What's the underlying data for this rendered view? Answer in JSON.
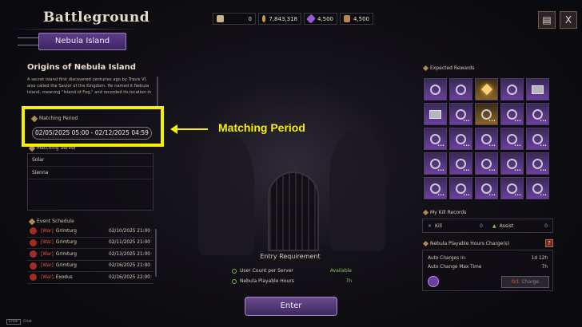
{
  "header": {
    "title": "Battleground",
    "active_tab": "Nebula Island",
    "currencies": [
      {
        "icon": "arrow-currency-icon",
        "value": "0",
        "color": "#c9b58a"
      },
      {
        "icon": "gold-coin-icon",
        "value": "7,843,318",
        "color": "#d79b3c"
      },
      {
        "icon": "purple-crystal-icon",
        "value": "4,500",
        "color": "#9a5ad6"
      },
      {
        "icon": "hexagon-token-icon",
        "value": "4,500",
        "color": "#b9864a"
      }
    ],
    "bag_icon": "bag-icon",
    "close_label": "X"
  },
  "origins": {
    "title": "Origins of Nebula Island",
    "text": "A secret island first discovered centuries ago by Travis VI, also called the Savior of the Kingdom. He named it Nebula Island, meaning \"Island of Fog,\" and recorded its location in"
  },
  "matching_period": {
    "label": "Matching Period",
    "value": "02/05/2025 05:00 - 02/12/2025 04:59"
  },
  "matching_server": {
    "label": "Matching Server",
    "servers": [
      "Solar",
      "Sienna"
    ]
  },
  "event_schedule": {
    "label": "Event Schedule",
    "rows": [
      {
        "tag": "[War]",
        "name": "Grimturg",
        "date": "02/10/2025 21:00"
      },
      {
        "tag": "[War]",
        "name": "Grimturg",
        "date": "02/11/2025 21:00"
      },
      {
        "tag": "[War]",
        "name": "Grimturg",
        "date": "02/13/2025 21:00"
      },
      {
        "tag": "[War]",
        "name": "Grimturg",
        "date": "02/16/2025 21:00"
      },
      {
        "tag": "[War]",
        "name": "Exodus",
        "date": "02/16/2025 22:00"
      }
    ]
  },
  "callout": {
    "text": "Matching Period",
    "color": "#f6f000"
  },
  "entry_requirement": {
    "title": "Entry Requirement",
    "rows": [
      {
        "label": "User Count per Server",
        "value": "Available"
      },
      {
        "label": "Nebula Playable Hours",
        "value": "7h"
      }
    ]
  },
  "enter_button": "Enter",
  "bottom_hint": {
    "key": "Enter",
    "label": "Chat"
  },
  "expected_rewards": {
    "label": "Expected Rewards",
    "items": [
      {
        "kind": "gem",
        "style": "purple",
        "dots": ""
      },
      {
        "kind": "gem",
        "style": "purple",
        "dots": ""
      },
      {
        "kind": "star",
        "style": "gold",
        "dots": ""
      },
      {
        "kind": "gem",
        "style": "purple",
        "dots": ""
      },
      {
        "kind": "box",
        "style": "purple",
        "dots": ""
      },
      {
        "kind": "box",
        "style": "purple",
        "dots": ""
      },
      {
        "kind": "gem",
        "style": "purple",
        "dots": "•••"
      },
      {
        "kind": "gem",
        "style": "gold",
        "dots": "•••"
      },
      {
        "kind": "gem",
        "style": "purple",
        "dots": "•••"
      },
      {
        "kind": "gem",
        "style": "purple",
        "dots": "•••"
      },
      {
        "kind": "gem",
        "style": "purple",
        "dots": "•••"
      },
      {
        "kind": "gem",
        "style": "purple",
        "dots": "•••"
      },
      {
        "kind": "gem",
        "style": "purple",
        "dots": "•••"
      },
      {
        "kind": "gem",
        "style": "purple",
        "dots": "•••"
      },
      {
        "kind": "gem",
        "style": "purple",
        "dots": "•••"
      },
      {
        "kind": "gem",
        "style": "purple",
        "dots": "•••"
      },
      {
        "kind": "gem",
        "style": "purple",
        "dots": "•••"
      },
      {
        "kind": "gem",
        "style": "purple",
        "dots": "•••"
      },
      {
        "kind": "gem",
        "style": "purple",
        "dots": "•••"
      },
      {
        "kind": "gem",
        "style": "purple",
        "dots": "•••"
      },
      {
        "kind": "gem",
        "style": "purple",
        "dots": "•••"
      },
      {
        "kind": "gem",
        "style": "purple",
        "dots": "•••"
      },
      {
        "kind": "gem",
        "style": "purple",
        "dots": "•••"
      },
      {
        "kind": "gem",
        "style": "purple",
        "dots": "•••"
      },
      {
        "kind": "gem",
        "style": "purple",
        "dots": "•••"
      }
    ]
  },
  "kill_records": {
    "label": "My Kill Records",
    "kill_label": "Kill",
    "kill_value": "0",
    "assist_label": "Assist",
    "assist_value": "0"
  },
  "playable_hours": {
    "label": "Nebula Playable Hours Charge(s)",
    "help": "?",
    "rows": [
      {
        "label": "Auto Charges in:",
        "value": "1d 12h"
      },
      {
        "label": "Auto Change Max Time",
        "value": "7h"
      }
    ],
    "charge_count": "0/1",
    "charge_label": "Charge"
  }
}
